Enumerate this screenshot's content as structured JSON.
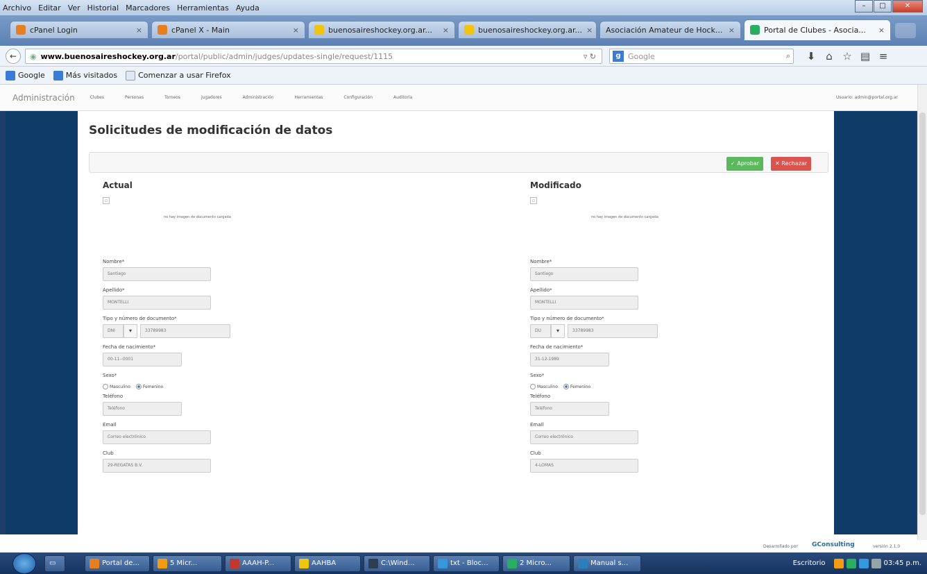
{
  "browser": {
    "menu": [
      "Archivo",
      "Editar",
      "Ver",
      "Historial",
      "Marcadores",
      "Herramientas",
      "Ayuda"
    ],
    "tabs": [
      {
        "label": "cPanel Login",
        "color": "#e67e22"
      },
      {
        "label": "cPanel X - Main",
        "color": "#e67e22"
      },
      {
        "label": "buenosaireshockey.org.ar...",
        "color": "#f1c40f"
      },
      {
        "label": "buenosaireshockey.org.ar...",
        "color": "#f1c40f"
      },
      {
        "label": "Asociación Amateur de Hock...",
        "color": "#2980b9"
      },
      {
        "label": "Portal de Clubes - Asocia...",
        "color": "#27ae60"
      }
    ],
    "url_host": "www.buenosaireshockey.org.ar",
    "url_path": "/portal/public/admin/judges/updates-single/request/1115",
    "search_placeholder": "Google",
    "bookmarks": [
      {
        "label": "Google",
        "color": "#3a7bd5"
      },
      {
        "label": "Más visitados",
        "color": "#3a7bd5"
      },
      {
        "label": "Comenzar a usar Firefox",
        "color": "#dfe7f0"
      }
    ]
  },
  "admin": {
    "brand": "Administración",
    "nav": [
      "Clubes",
      "Personas",
      "Torneos",
      "Jugadores",
      "Administración",
      "Herramientas",
      "Configuración",
      "Auditoría"
    ],
    "user": "Usuario: admin@portal.org.ar"
  },
  "page": {
    "title": "Solicitudes de modificación de datos",
    "approve_label": "Aprobar",
    "reject_label": "Rechazar",
    "no_image": "no hay imagen de documento cargada",
    "labels": {
      "nombre": "Nombre*",
      "apellido": "Apellido*",
      "documento": "Tipo y número de documento*",
      "nacimiento": "Fecha de nacimiento*",
      "sexo": "Sexo*",
      "masculino": "Masculino",
      "femenino": "Femenino",
      "telefono": "Teléfono",
      "email": "Email",
      "club": "Club"
    },
    "actual": {
      "heading": "Actual",
      "nombre": "Santiago",
      "apellido": "MONTELLI",
      "doc_tipo": "DNI",
      "doc_num": "33789983",
      "nacimiento": "00-11--0001",
      "telefono": "Teléfono",
      "email": "Correo electrónico",
      "club": "29-REGATAS B.V."
    },
    "modificado": {
      "heading": "Modificado",
      "nombre": "Santiago",
      "apellido": "MONTELLI",
      "doc_tipo": "DU",
      "doc_num": "33789983",
      "nacimiento": "31-12-1989",
      "telefono": "Teléfono",
      "email": "Correo electrónico",
      "club": "4-LOMAS"
    }
  },
  "footer": {
    "developed_by": "Desarrollado por",
    "company": "GConsulting",
    "version": "versión 2.1.0"
  },
  "taskbar": {
    "items": [
      {
        "label": "Portal de...",
        "color": "#e67e22"
      },
      {
        "label": "5 Micr...",
        "color": "#f39c12"
      },
      {
        "label": "AAAH-P...",
        "color": "#c0392b"
      },
      {
        "label": "AAHBA",
        "color": "#f1c40f"
      },
      {
        "label": "C:\\Wind...",
        "color": "#2c3e50"
      },
      {
        "label": "txt - Bloc...",
        "color": "#3498db"
      },
      {
        "label": "2 Micro...",
        "color": "#27ae60"
      },
      {
        "label": "Manual s...",
        "color": "#2980b9"
      }
    ],
    "desktop": "Escritorio",
    "time": "03:45 p.m."
  }
}
